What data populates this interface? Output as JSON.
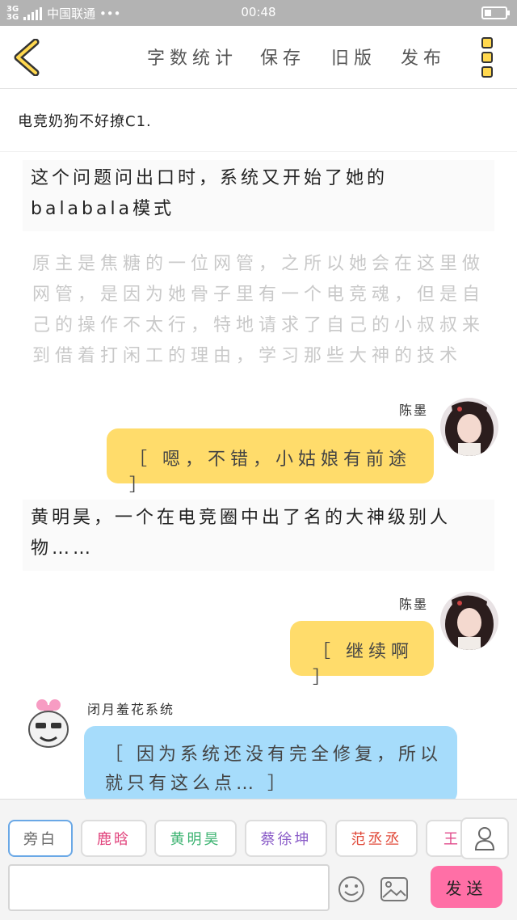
{
  "status_bar": {
    "network_a": "3G",
    "network_b": "3G",
    "carrier": "中国联通 •••",
    "time": "00:48",
    "battery_level": 0.35
  },
  "toolbar": {
    "back_icon": "chevron-left-icon",
    "word_count_label": "字数统计",
    "save_label": "保存",
    "old_version_label": "旧版",
    "publish_label": "发布",
    "more_icon": "three-squares-menu-icon",
    "accent_color": "#ffd84f"
  },
  "title": "电竞奶狗不好撩C1.",
  "content": {
    "narration_1": [
      "这个问题问出口时，系统又开始了她的",
      "balabala模式"
    ],
    "faded_text": [
      "原主是焦糖的一位网管，之所以她会在这里做",
      "网管，是因为她骨子里有一个电竞魂，但是自",
      "己的操作不太行，特地请求了自己的小叔叔来",
      "到借着打闲工的理由，学习那些大神的技术"
    ],
    "message_1": {
      "speaker": "陈墨",
      "text": "［ 嗯，不错，小姑娘有前途 ］",
      "bubble_color": "#ffdc6b"
    },
    "narration_2": [
      "黄明昊，一个在电竞圈中出了名的大神级别人",
      "物……"
    ],
    "message_2": {
      "speaker": "陈墨",
      "text": "［ 继续啊 ］",
      "bubble_color": "#ffdc6b"
    },
    "message_3": {
      "speaker": "闭月羞花系统",
      "text": [
        "［ 因为系统还没有完全修复，所以",
        "就只有这么点… ］"
      ],
      "bubble_color": "#a6dcfb"
    }
  },
  "composer": {
    "characters": [
      {
        "name": "旁白",
        "color": "#666666"
      },
      {
        "name": "鹿晗",
        "color": "#e0407a"
      },
      {
        "name": "黄明昊",
        "color": "#3cb371"
      },
      {
        "name": "蔡徐坤",
        "color": "#8a5cc8"
      },
      {
        "name": "范丞丞",
        "color": "#e04a3a"
      },
      {
        "name": "王",
        "color": "#e04a8a"
      }
    ],
    "user_icon": "user-icon",
    "input_value": "",
    "emoji_icon": "smiley-icon",
    "image_icon": "image-icon",
    "send_label": "发送",
    "send_color": "#ff6fa6"
  }
}
